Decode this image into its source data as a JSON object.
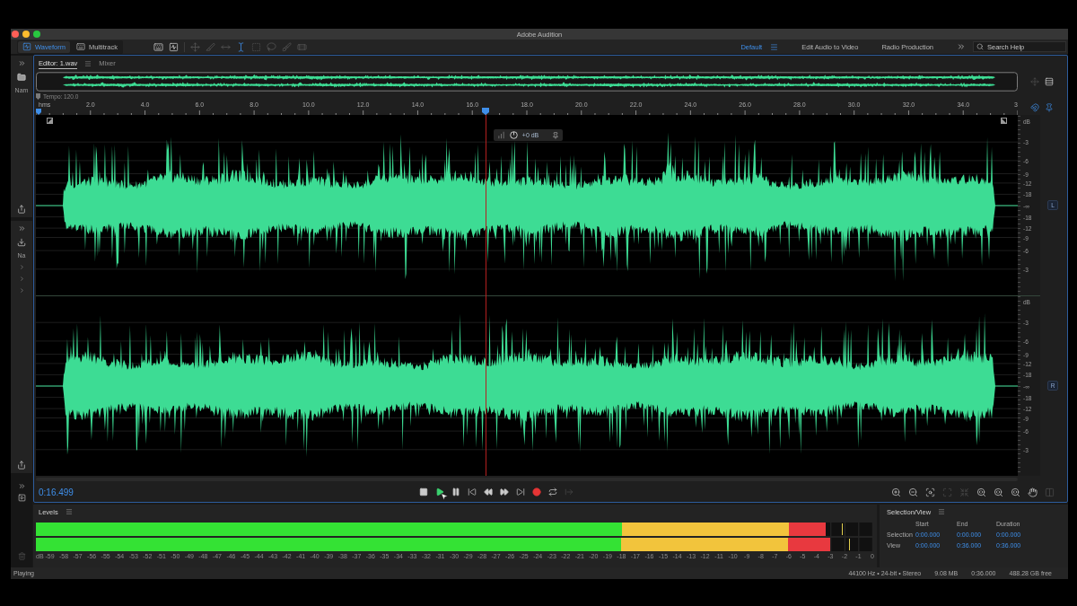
{
  "window": {
    "title": "Adobe Audition"
  },
  "toolbar": {
    "modes": [
      {
        "kind": "waveform",
        "label": "Waveform",
        "selected": true
      },
      {
        "kind": "multitrack",
        "label": "Multitrack",
        "selected": false
      }
    ],
    "tools": [
      {
        "kind": "keyboard",
        "selected": false,
        "disabled": false
      },
      {
        "kind": "waveform-box",
        "selected": false,
        "disabled": false
      },
      {
        "kind": "move",
        "selected": false,
        "disabled": true
      },
      {
        "kind": "razor",
        "selected": false,
        "disabled": true
      },
      {
        "kind": "slip",
        "selected": false,
        "disabled": true
      },
      {
        "kind": "time-selection",
        "selected": true,
        "disabled": false
      },
      {
        "kind": "marquee",
        "selected": false,
        "disabled": true
      },
      {
        "kind": "lasso",
        "selected": false,
        "disabled": true
      },
      {
        "kind": "brush",
        "selected": false,
        "disabled": true
      },
      {
        "kind": "healing",
        "selected": false,
        "disabled": true
      }
    ],
    "workspaces": [
      {
        "label": "Default",
        "selected": true
      },
      {
        "label": "Edit Audio to Video",
        "selected": false
      },
      {
        "label": "Radio Production",
        "selected": false
      }
    ],
    "search": {
      "placeholder": "Search Help"
    }
  },
  "side_panels": [
    {
      "kind": "files",
      "label": "Nam"
    },
    {
      "kind": "media",
      "label": "Na"
    }
  ],
  "editor": {
    "tabs": [
      {
        "label": "Editor: 1.wav",
        "selected": true
      },
      {
        "label": "Mixer",
        "selected": false
      }
    ],
    "tempo": "Tempo: 120.0",
    "ruler": {
      "unit": "hms",
      "ticks": [
        "2.0",
        "4.0",
        "6.0",
        "8.0",
        "10.0",
        "12.0",
        "14.0",
        "16.0",
        "18.0",
        "20.0",
        "22.0",
        "24.0",
        "26.0",
        "28.0",
        "30.0",
        "32.0",
        "34.0",
        "3"
      ]
    },
    "snap_tools": [
      {
        "kind": "magnet",
        "on": true
      },
      {
        "kind": "pin",
        "on": true
      }
    ],
    "playhead": {
      "level": 0.4583
    },
    "hud": {
      "gain": "+0 dB"
    },
    "channels": [
      {
        "badge": "L",
        "scale": [
          "dB",
          "-3",
          "-6",
          "-9",
          "-12",
          "-18",
          "-∞",
          "-18",
          "-12",
          "-9",
          "-6",
          "-3"
        ]
      },
      {
        "badge": "R",
        "scale": [
          "dB",
          "-3",
          "-6",
          "-9",
          "-12",
          "-18",
          "-∞",
          "-18",
          "-12",
          "-9",
          "-6",
          "-3"
        ]
      }
    ]
  },
  "transport": {
    "time": "0:16.499",
    "buttons": [
      {
        "kind": "stop",
        "on": false,
        "disabled": false
      },
      {
        "kind": "play",
        "on": true,
        "disabled": false
      },
      {
        "kind": "pause",
        "on": false,
        "disabled": false
      },
      {
        "kind": "to-start",
        "on": false,
        "disabled": false
      },
      {
        "kind": "rewind",
        "on": false,
        "disabled": false
      },
      {
        "kind": "fast-forward",
        "on": false,
        "disabled": false
      },
      {
        "kind": "to-end",
        "on": false,
        "disabled": false
      },
      {
        "kind": "record",
        "on": false,
        "disabled": false
      },
      {
        "kind": "loop",
        "on": false,
        "disabled": false
      },
      {
        "kind": "skip",
        "on": false,
        "disabled": true
      }
    ],
    "zoom_buttons": [
      {
        "kind": "zoom-in",
        "disabled": false
      },
      {
        "kind": "zoom-out",
        "disabled": false
      },
      {
        "kind": "zoom-scan",
        "disabled": false
      },
      {
        "kind": "zoom-full",
        "disabled": true
      },
      {
        "kind": "zoom-shrink",
        "disabled": true
      },
      {
        "kind": "zoom-left",
        "disabled": false
      },
      {
        "kind": "zoom-right",
        "disabled": false
      },
      {
        "kind": "zoom-both",
        "disabled": false
      },
      {
        "kind": "hand",
        "disabled": false
      },
      {
        "kind": "columns",
        "disabled": true
      }
    ]
  },
  "levels": {
    "title": "Levels",
    "meters": [
      {
        "level": 0.944,
        "peak": {
          "level": 0.964
        }
      },
      {
        "level": 0.95,
        "peak": {
          "level": 0.972
        }
      }
    ],
    "scale": [
      "dB",
      "-59",
      "-58",
      "-57",
      "-56",
      "-55",
      "-54",
      "-53",
      "-52",
      "-51",
      "-50",
      "-49",
      "-48",
      "-47",
      "-46",
      "-45",
      "-44",
      "-43",
      "-42",
      "-41",
      "-40",
      "-39",
      "-38",
      "-37",
      "-36",
      "-35",
      "-34",
      "-33",
      "-32",
      "-31",
      "-30",
      "-29",
      "-28",
      "-27",
      "-26",
      "-25",
      "-24",
      "-23",
      "-22",
      "-21",
      "-20",
      "-19",
      "-18",
      "-17",
      "-16",
      "-15",
      "-14",
      "-13",
      "-12",
      "-11",
      "-10",
      "-9",
      "-8",
      "-7",
      "-6",
      "-5",
      "-4",
      "-3",
      "-2",
      "-1",
      "0"
    ]
  },
  "selection_view": {
    "title": "Selection/View",
    "columns": [
      "Start",
      "End",
      "Duration"
    ],
    "rows": [
      {
        "label": "Selection",
        "values": [
          "0:00.000",
          "0:00.000",
          "0:00.000"
        ]
      },
      {
        "label": "View",
        "values": [
          "0:00.000",
          "0:36.000",
          "0:36.000"
        ]
      }
    ]
  },
  "status_bar": {
    "state": "Playing",
    "items": [
      "44100 Hz • 24-bit • Stereo",
      "9.08 MB",
      "0:36.000",
      "488.28 GB free"
    ]
  }
}
